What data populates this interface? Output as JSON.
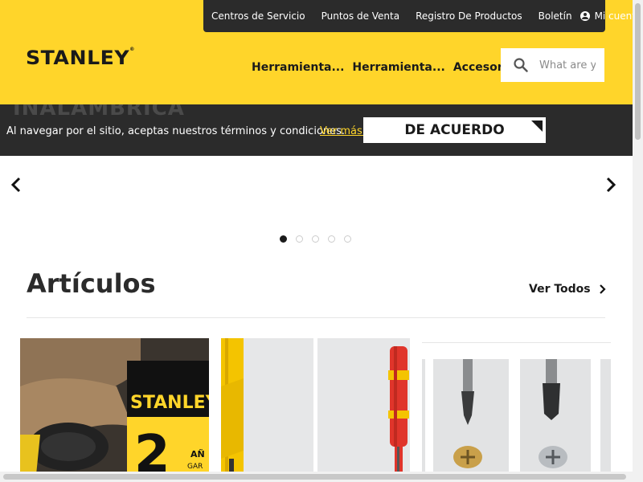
{
  "topbar": {
    "links": [
      "Centros de Servicio",
      "Puntos de Venta",
      "Registro De Productos",
      "Boletín"
    ],
    "account_label": "Mi cuenta"
  },
  "brand": {
    "logo_text": "STANLEY"
  },
  "main_nav": {
    "items": [
      "Herramienta...",
      "Herramienta...",
      "Accesorios"
    ]
  },
  "search": {
    "placeholder": "What are you looking for?",
    "icon": "search-icon"
  },
  "cookie_banner": {
    "background_text": "INALÁMBRICA",
    "message": "Al navegar por el sitio, aceptas nuestros términos y condiciones.",
    "more_link": "Ver más.",
    "accept_button": "DE ACUERDO"
  },
  "carousel": {
    "slide_count": 5,
    "active_index": 0
  },
  "articles": {
    "title": "Artículos",
    "view_all": "Ver Todos"
  },
  "promo": {
    "brand": "STANLEY",
    "big_number": "2",
    "years_text": "AÑ",
    "guarantee_text": "GAR"
  },
  "colors": {
    "brand_yellow": "#ffd52a",
    "dark": "#2b2b2b"
  }
}
